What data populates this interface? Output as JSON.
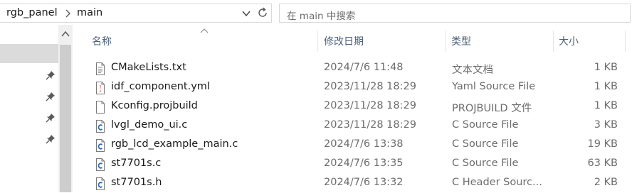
{
  "address_bar": {
    "breadcrumbs": [
      "rgb_panel",
      "main"
    ],
    "separator_icon": "chevron-right-icon",
    "dropdown_icon": "chevron-down-icon",
    "refresh_icon": "refresh-icon"
  },
  "search": {
    "placeholder": "在 main 中搜索"
  },
  "nav": {
    "pinned_items": 4,
    "pin_icon": "pin-icon"
  },
  "columns": {
    "name": "名称",
    "date": "修改日期",
    "type": "类型",
    "size": "大小",
    "sort_icon": "sort-ascending-caret-icon"
  },
  "files": [
    {
      "name": "CMakeLists.txt",
      "date": "2024/7/6 11:48",
      "type": "文本文档",
      "size": "1 KB",
      "icon": "text-file-icon"
    },
    {
      "name": "idf_component.yml",
      "date": "2023/11/28 18:29",
      "type": "Yaml Source File",
      "size": "1 KB",
      "icon": "yaml-file-icon"
    },
    {
      "name": "Kconfig.projbuild",
      "date": "2023/11/28 18:29",
      "type": "PROJBUILD 文件",
      "size": "1 KB",
      "icon": "blank-file-icon"
    },
    {
      "name": "lvgl_demo_ui.c",
      "date": "2023/11/28 18:29",
      "type": "C Source File",
      "size": "3 KB",
      "icon": "c-source-file-icon"
    },
    {
      "name": "rgb_lcd_example_main.c",
      "date": "2024/7/6 13:38",
      "type": "C Source File",
      "size": "19 KB",
      "icon": "c-source-file-icon"
    },
    {
      "name": "st7701s.c",
      "date": "2024/7/6 13:35",
      "type": "C Source File",
      "size": "63 KB",
      "icon": "c-source-file-icon"
    },
    {
      "name": "st7701s.h",
      "date": "2024/7/6 13:32",
      "type": "C Header Sourc...",
      "size": "2 KB",
      "icon": "c-header-file-icon"
    }
  ]
}
